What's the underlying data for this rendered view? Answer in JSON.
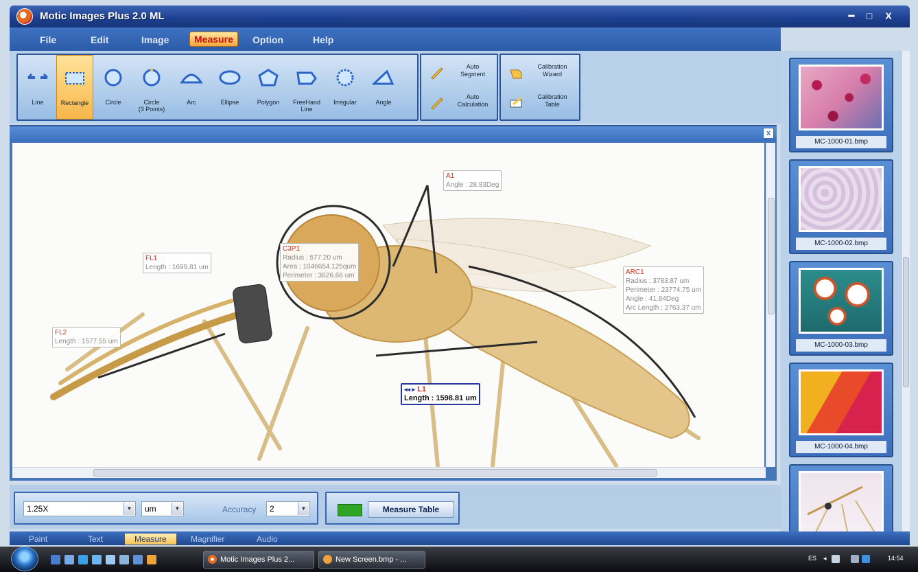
{
  "window": {
    "title": "Motic Images Plus 2.0 ML",
    "minimize": "━",
    "maximize": "□",
    "close": "X"
  },
  "menu": [
    "File",
    "Edit",
    "Image",
    "Measure",
    "Option",
    "Help"
  ],
  "menu_active": "Measure",
  "tools": [
    {
      "label": "Line",
      "icon": "line-icon"
    },
    {
      "label": "Rectangle",
      "icon": "rectangle-icon"
    },
    {
      "label": "Circle",
      "icon": "circle-icon"
    },
    {
      "label": "Circle\n(3 Points)",
      "icon": "circle-3points-icon"
    },
    {
      "label": "Arc",
      "icon": "arc-icon"
    },
    {
      "label": "Ellipse",
      "icon": "ellipse-icon"
    },
    {
      "label": "Polygon",
      "icon": "polygon-icon"
    },
    {
      "label": "FreeHand\nLine",
      "icon": "freehand-icon"
    },
    {
      "label": "Irregular",
      "icon": "irregular-icon"
    },
    {
      "label": "Angle",
      "icon": "angle-icon"
    }
  ],
  "auto_tools": [
    {
      "label": "Auto\nSegment",
      "icon": "pencil-icon"
    },
    {
      "label": "Auto\nCalculation",
      "icon": "pencil-icon"
    }
  ],
  "calibration_tools": [
    {
      "label": "Calibration\nWizard",
      "icon": "hand-pointer-icon"
    },
    {
      "label": "Calibration\nTable",
      "icon": "calibration-table-icon"
    }
  ],
  "panel": {
    "close": "x"
  },
  "measurements": {
    "a1": {
      "name": "A1",
      "lines": [
        "Angle : 28.83Deg"
      ]
    },
    "fl1": {
      "name": "FL1",
      "lines": [
        "Length : 1699.81 um"
      ]
    },
    "c3p1": {
      "name": "C3P1",
      "lines": [
        "Radius : 577.20 um",
        "Area : 1046654.125qum",
        "Perimeter : 3626.66 um"
      ]
    },
    "arc1": {
      "name": "ARC1",
      "lines": [
        "Radius : 3783.87 um",
        "Perimeter : 23774.75 um",
        "Angle : 41.84Deg",
        "Arc Length : 2763.37 um"
      ]
    },
    "fl2": {
      "name": "FL2",
      "lines": [
        "Length : 1577.55 um"
      ]
    },
    "l1": {
      "name": "L1",
      "nav": "◂◂ ▸",
      "lines": [
        "Length : 1598.81 um"
      ]
    }
  },
  "controls": {
    "magnification": "1.25X",
    "unit": "um",
    "accuracy_label": "Accuracy",
    "accuracy_value": "2",
    "measure_table": "Measure Table",
    "swatch_color": "#2ea623"
  },
  "bottom_tabs": [
    "Paint",
    "Text",
    "Measure",
    "Magnifier",
    "Audio"
  ],
  "bottom_tab_active": "Measure",
  "thumbnails": [
    "MC-1000-01.bmp",
    "MC-1000-02.bmp",
    "MC-1000-03.bmp",
    "MC-1000-04.bmp",
    ""
  ],
  "taskbar": {
    "tasks": [
      "Motic Images Plus 2...",
      "New Screen.bmp - ..."
    ],
    "lang": "ES",
    "time": "14:54"
  }
}
